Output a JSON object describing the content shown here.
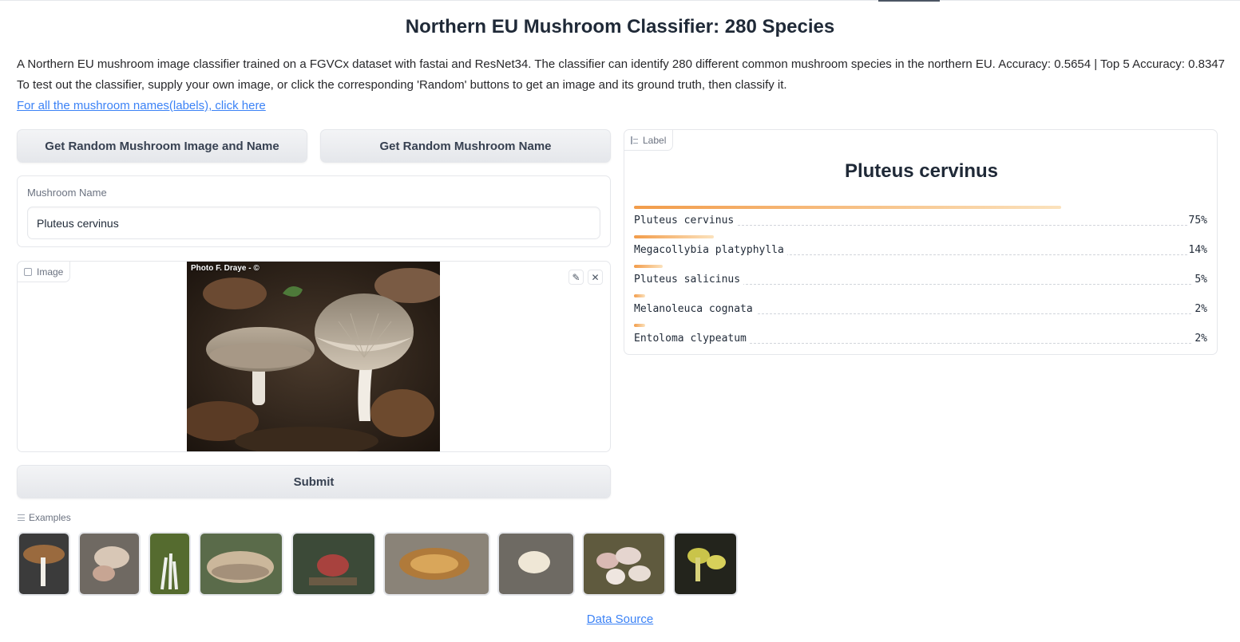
{
  "header": {
    "title": "Northern EU Mushroom Classifier: 280 Species"
  },
  "description": {
    "line1": "A Northern EU mushroom image classifier trained on a FGVCx dataset with fastai and ResNet34. The classifier can identify 280 different common mushroom species in the northern EU. Accuracy: 0.5654 | Top 5 Accuracy: 0.8347",
    "line2": "To test out the classifier, supply your own image, or click the corresponding 'Random' buttons to get an image and its ground truth, then classify it.",
    "labels_link": "For all the mushroom names(labels), click here"
  },
  "buttons": {
    "random_image_and_name": "Get Random Mushroom Image and Name",
    "random_name": "Get Random Mushroom Name",
    "submit": "Submit"
  },
  "name_field": {
    "label": "Mushroom Name",
    "value": "Pluteus cervinus"
  },
  "image_block": {
    "label": "Image",
    "photo_credit": "Photo F. Draye - ©",
    "edit_icon": "pencil-icon",
    "close_icon": "close-icon",
    "edit_glyph": "✎",
    "close_glyph": "✕"
  },
  "label_block": {
    "label": "Label",
    "top_prediction": "Pluteus cervinus",
    "confidences": [
      {
        "name": "Pluteus cervinus",
        "pct_text": "75%",
        "value": 0.75
      },
      {
        "name": "Megacollybia platyphylla",
        "pct_text": "14%",
        "value": 0.14
      },
      {
        "name": "Pluteus salicinus",
        "pct_text": "5%",
        "value": 0.05
      },
      {
        "name": "Melanoleuca cognata",
        "pct_text": "2%",
        "value": 0.02
      },
      {
        "name": "Entoloma clypeatum",
        "pct_text": "2%",
        "value": 0.02
      }
    ]
  },
  "examples": {
    "label": "Examples"
  },
  "footer": {
    "data_source": "Data Source"
  },
  "colors": {
    "bar_start": "#f29c4a",
    "bar_end": "#fbe2bd",
    "link": "#3b82f6"
  }
}
